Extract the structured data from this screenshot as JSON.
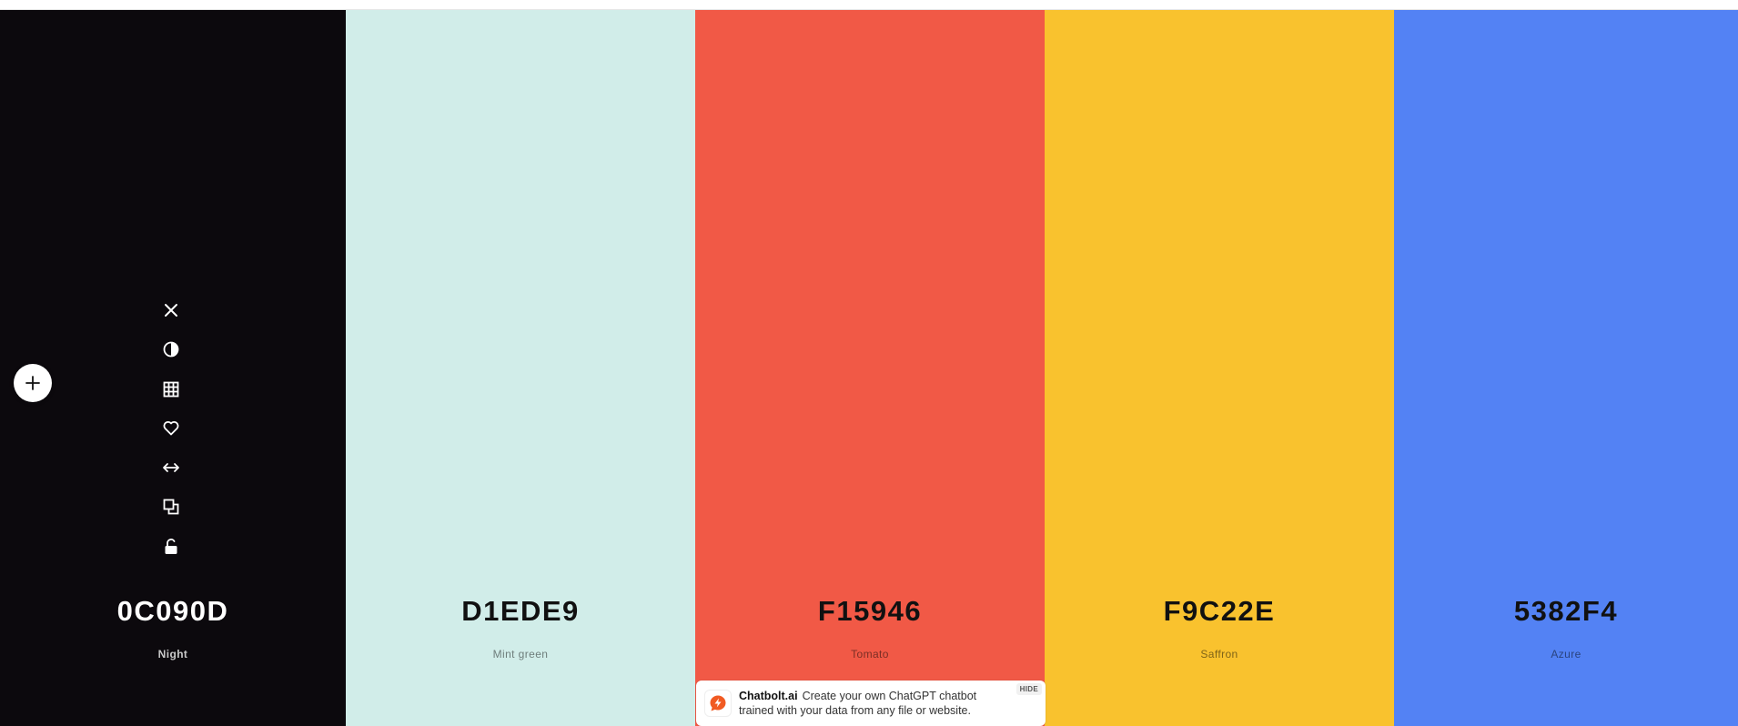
{
  "palette": [
    {
      "hex": "0C090D",
      "name": "Night",
      "bg": "#0C090D",
      "text_color": "#FFFFFF",
      "name_color": "#C9C9C9"
    },
    {
      "hex": "D1EDE9",
      "name": "Mint green",
      "bg": "#D1EDE9",
      "text_color": "#111111",
      "name_color": "#6E7D7B"
    },
    {
      "hex": "F15946",
      "name": "Tomato",
      "bg": "#F15946",
      "text_color": "#111111",
      "name_color": "#7A2E25"
    },
    {
      "hex": "F9C22E",
      "name": "Saffron",
      "bg": "#F9C22E",
      "text_color": "#111111",
      "name_color": "#7F6418"
    },
    {
      "hex": "5382F4",
      "name": "Azure",
      "bg": "#5382F4",
      "text_color": "#111111",
      "name_color": "#2A437E"
    }
  ],
  "toolbar": {
    "tools": [
      {
        "icon": "close-icon"
      },
      {
        "icon": "contrast-icon"
      },
      {
        "icon": "grid-icon"
      },
      {
        "icon": "heart-icon"
      },
      {
        "icon": "drag-arrows-icon"
      },
      {
        "icon": "copy-icon"
      },
      {
        "icon": "unlock-icon"
      }
    ],
    "add_icon": "plus-icon"
  },
  "ad": {
    "brand": "Chatbolt.ai",
    "text": "Create your own ChatGPT chatbot trained with your data from any file or website.",
    "hide_label": "HIDE",
    "accent": "#F15A22"
  }
}
